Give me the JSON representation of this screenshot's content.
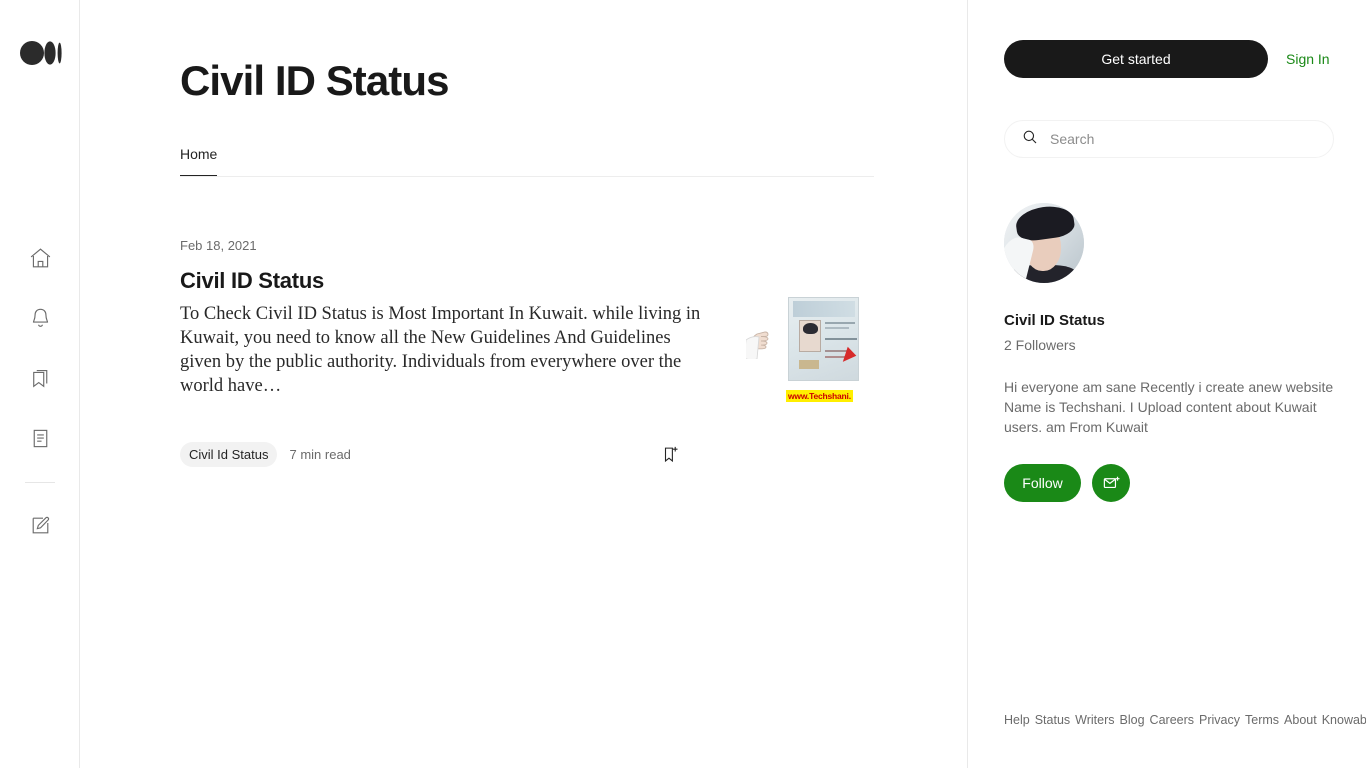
{
  "brand": {
    "logo_name": "medium-logo"
  },
  "rail": {
    "items": [
      {
        "name": "home",
        "icon": "home-icon"
      },
      {
        "name": "notifications",
        "icon": "bell-icon"
      },
      {
        "name": "lists",
        "icon": "bookmark-icon"
      },
      {
        "name": "stories",
        "icon": "document-icon"
      },
      {
        "name": "write",
        "icon": "write-pencil-icon"
      }
    ]
  },
  "publication": {
    "title": "Civil ID Status",
    "tabs": [
      {
        "label": "Home",
        "active": true
      }
    ]
  },
  "article": {
    "date": "Feb 18, 2021",
    "title": "Civil ID Status",
    "excerpt": "To Check Civil ID Status is Most Important In Kuwait. while living in Kuwait, you need to know all the New Guidelines And Guidelines given by the public authority. Individuals from everywhere over the world have…",
    "tag": "Civil Id Status",
    "read_time": "7 min read",
    "bookmark_icon": "bookmark-add-icon",
    "thumbnail": {
      "alt": "Kuwait civil ID card with pointing hand",
      "watermark": "www.Techshani."
    }
  },
  "sidebar": {
    "get_started_label": "Get started",
    "sign_in_label": "Sign In",
    "search": {
      "placeholder": "Search",
      "value": "",
      "icon": "search-icon"
    },
    "profile": {
      "avatar_icon": "avatar",
      "name": "Civil ID Status",
      "followers": "2 Followers",
      "bio": "Hi everyone am sane Recently i create anew website Name is Techshani. I Upload content about Kuwait users. am From Kuwait",
      "follow_label": "Follow",
      "mail_icon": "mail-add-icon"
    },
    "footer_links": [
      "Help",
      "Status",
      "Writers",
      "Blog",
      "Careers",
      "Privacy",
      "Terms",
      "About",
      "Knowable"
    ]
  },
  "colors": {
    "accent_green": "#1a8917",
    "text_primary": "#191919",
    "text_secondary": "#6b6b6b",
    "dark_button": "#191919"
  }
}
